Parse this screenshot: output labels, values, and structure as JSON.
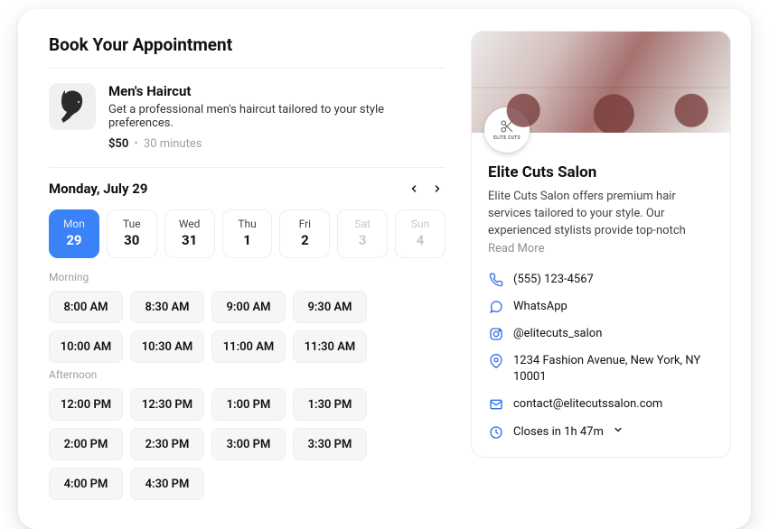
{
  "page": {
    "title": "Book Your Appointment"
  },
  "service": {
    "name": "Men's Haircut",
    "description": "Get a professional men's haircut tailored to your style preferences.",
    "price": "$50",
    "duration": "30 minutes"
  },
  "calendar": {
    "selected_label": "Monday, July 29",
    "days": [
      {
        "dow": "Mon",
        "num": "29",
        "state": "active"
      },
      {
        "dow": "Tue",
        "num": "30",
        "state": ""
      },
      {
        "dow": "Wed",
        "num": "31",
        "state": ""
      },
      {
        "dow": "Thu",
        "num": "1",
        "state": ""
      },
      {
        "dow": "Fri",
        "num": "2",
        "state": ""
      },
      {
        "dow": "Sat",
        "num": "3",
        "state": "disabled"
      },
      {
        "dow": "Sun",
        "num": "4",
        "state": "disabled"
      }
    ]
  },
  "slots": {
    "morning_label": "Morning",
    "afternoon_label": "Afternoon",
    "morning": [
      "8:00 AM",
      "8:30 AM",
      "9:00 AM",
      "9:30 AM",
      "10:00 AM",
      "10:30 AM",
      "11:00 AM",
      "11:30 AM"
    ],
    "afternoon": [
      "12:00 PM",
      "12:30 PM",
      "1:00 PM",
      "1:30 PM",
      "2:00 PM",
      "2:30 PM",
      "3:00 PM",
      "3:30 PM",
      "4:00 PM",
      "4:30 PM"
    ]
  },
  "business": {
    "logo_text": "ELITE CUTS",
    "name": "Elite Cuts Salon",
    "description": "Elite Cuts Salon offers premium hair services tailored to your style. Our experienced stylists provide top-notch",
    "read_more": "Read More",
    "phone": "(555) 123-4567",
    "whatsapp": "WhatsApp",
    "instagram": "@elitecuts_salon",
    "address": "1234 Fashion Avenue, New York, NY 10001",
    "email": "contact@elitecutssalon.com",
    "hours": "Closes in 1h 47m"
  }
}
